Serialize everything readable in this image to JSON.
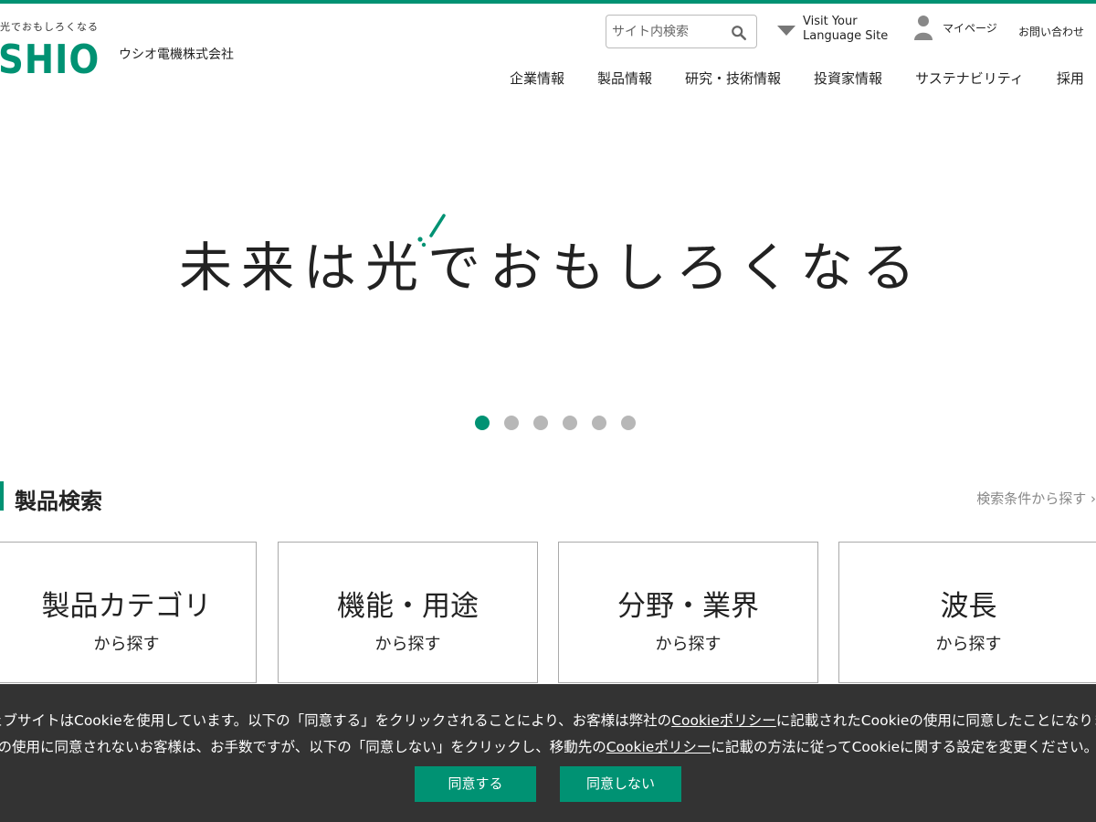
{
  "brand": {
    "tagline": "光でおもしろくなる",
    "wordmark": "SHIO",
    "company": "ウシオ電機株式会社",
    "color": "#009273"
  },
  "header": {
    "search_placeholder": "サイト内検索",
    "lang_link": "Visit Your\nLanguage Site",
    "mypage": "マイページ",
    "contact": "お問い合わせ"
  },
  "nav": [
    {
      "label": "企業情報"
    },
    {
      "label": "製品情報"
    },
    {
      "label": "研究・技術情報"
    },
    {
      "label": "投資家情報"
    },
    {
      "label": "サステナビリティ"
    },
    {
      "label": "採用"
    }
  ],
  "hero": {
    "title": "未来は光でおもしろくなる",
    "slides_total": 6,
    "active_slide": 1
  },
  "product_search": {
    "title": "製品検索",
    "link": "検索条件から探す ›",
    "cards": [
      {
        "title": "製品カテゴリ",
        "sub": "から探す"
      },
      {
        "title": "機能・用途",
        "sub": "から探す"
      },
      {
        "title": "分野・業界",
        "sub": "から探す"
      },
      {
        "title": "波長",
        "sub": "から探す"
      }
    ]
  },
  "cookie": {
    "line1_a": "ェブサイトはCookieを使用しています。以下の「同意する」をクリックされることにより、お客様は弊社の",
    "line1_link": "Cookieポリシー",
    "line1_b": "に記載されたCookieの使用に同意したことになりま",
    "line2_a": "eの使用に同意されないお客様は、お手数ですが、以下の「同意しない」をクリックし、移動先の",
    "line2_link": "Cookieポリシー",
    "line2_b": "に記載の方法に従ってCookieに関する設定を変更ください。",
    "agree": "同意する",
    "disagree": "同意しない"
  }
}
